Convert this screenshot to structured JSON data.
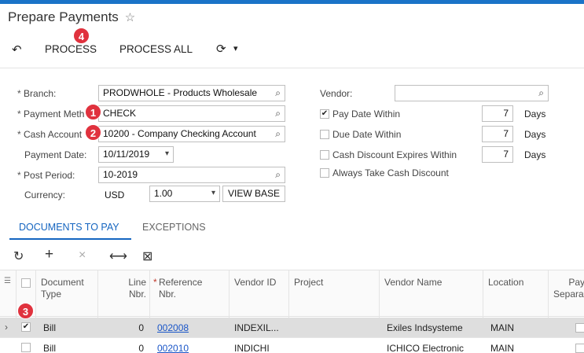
{
  "page": {
    "title": "Prepare Payments",
    "star_icon": "☆"
  },
  "toolbar": {
    "undo_icon": "↶",
    "process_label": "PROCESS",
    "process_all_label": "PROCESS ALL",
    "schedule_icon": "⟳",
    "dropdown_icon": "▾"
  },
  "badges": {
    "b1": "1",
    "b2": "2",
    "b3": "3",
    "b4": "4"
  },
  "form": {
    "branch": {
      "label": "Branch:",
      "value": "PRODWHOLE - Products Wholesale"
    },
    "payment_method": {
      "label": "Payment Meth",
      "value": "CHECK"
    },
    "cash_account": {
      "label": "Cash Account",
      "value": "10200 - Company Checking Account"
    },
    "payment_date": {
      "label": "Payment Date:",
      "value": "10/11/2019"
    },
    "post_period": {
      "label": "Post Period:",
      "value": "10-2019"
    },
    "currency": {
      "label": "Currency:",
      "value": "USD",
      "rate": "1.00",
      "view_base_label": "VIEW BASE"
    },
    "vendor": {
      "label": "Vendor:",
      "value": ""
    },
    "pay_date_within": {
      "label": "Pay Date Within",
      "checked": true,
      "days": "7",
      "days_label": "Days"
    },
    "due_date_within": {
      "label": "Due Date Within",
      "checked": false,
      "days": "7",
      "days_label": "Days"
    },
    "cash_discount": {
      "label": "Cash Discount Expires Within",
      "checked": false,
      "days": "7",
      "days_label": "Days"
    },
    "always_take": {
      "label": "Always Take Cash Discount",
      "checked": false
    },
    "required_mark": "*",
    "lookup_icon": "⌕",
    "caret": "▾",
    "check_mark": "✔"
  },
  "tabs": [
    {
      "label": "DOCUMENTS TO PAY",
      "active": true
    },
    {
      "label": "EXCEPTIONS",
      "active": false
    }
  ],
  "grid_toolbar": {
    "refresh_icon": "↻",
    "add_icon": "+",
    "delete_icon": "×",
    "fit_icon": "⟷",
    "excel_icon": "⊠"
  },
  "grid": {
    "headers": [
      "Document Type",
      "Line Nbr.",
      "Reference Nbr.",
      "Vendor ID",
      "Project",
      "Vendor Name",
      "Location",
      "Pay Separately"
    ],
    "header_display": {
      "doc_type": "Document\nType",
      "line_nbr": "Line\nNbr.",
      "ref_nbr": "Reference\nNbr.",
      "vendor_id": "Vendor ID",
      "project": "Project",
      "vendor_name": "Vendor Name",
      "location": "Location",
      "pay_sep": "Pay\nSeparat"
    },
    "rows": [
      {
        "selected": true,
        "type": "Bill",
        "line": "0",
        "ref": "002008",
        "vendor_id": "INDEXIL...",
        "project": "",
        "vendor_name": "Exiles Indsysteme",
        "location": "MAIN"
      },
      {
        "selected": false,
        "type": "Bill",
        "line": "0",
        "ref": "002010",
        "vendor_id": "INDICHI",
        "project": "",
        "vendor_name": "ICHICO Electronic",
        "location": "MAIN"
      }
    ]
  }
}
